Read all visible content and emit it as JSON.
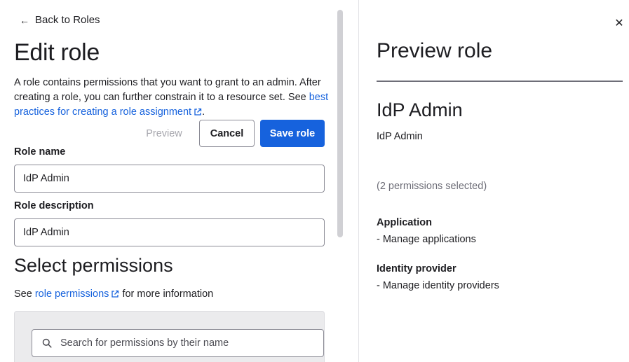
{
  "left": {
    "back_label": "Back to Roles",
    "title": "Edit role",
    "intro_text": "A role contains permissions that you want to grant to an admin. After creating a role, you can further constrain it to a resource set. See ",
    "intro_link": "best practices for creating a role assignment",
    "intro_end": ".",
    "buttons": {
      "preview": "Preview",
      "cancel": "Cancel",
      "save": "Save role"
    },
    "role_name_label": "Role name",
    "role_name_value": "IdP Admin",
    "role_desc_label": "Role description",
    "role_desc_value": "IdP Admin",
    "select_title": "Select permissions",
    "perm_info_prefix": "See ",
    "perm_info_link": "role permissions",
    "perm_info_suffix": " for more information",
    "search_placeholder": "Search for permissions by their name"
  },
  "preview": {
    "title": "Preview role",
    "role_name": "IdP Admin",
    "role_description": "IdP Admin",
    "permissions_count": "(2 permissions selected)",
    "groups": [
      {
        "title": "Application",
        "item": "- Manage applications"
      },
      {
        "title": "Identity provider",
        "item": "- Manage identity providers"
      }
    ]
  },
  "colors": {
    "accent": "#1662dd",
    "text": "#1d1d21",
    "muted": "#6e6e78",
    "disabled": "#a6a6ad"
  },
  "icons": {
    "back": "arrow-left-icon",
    "external": "external-link-icon",
    "search": "search-icon",
    "close": "close-icon"
  }
}
